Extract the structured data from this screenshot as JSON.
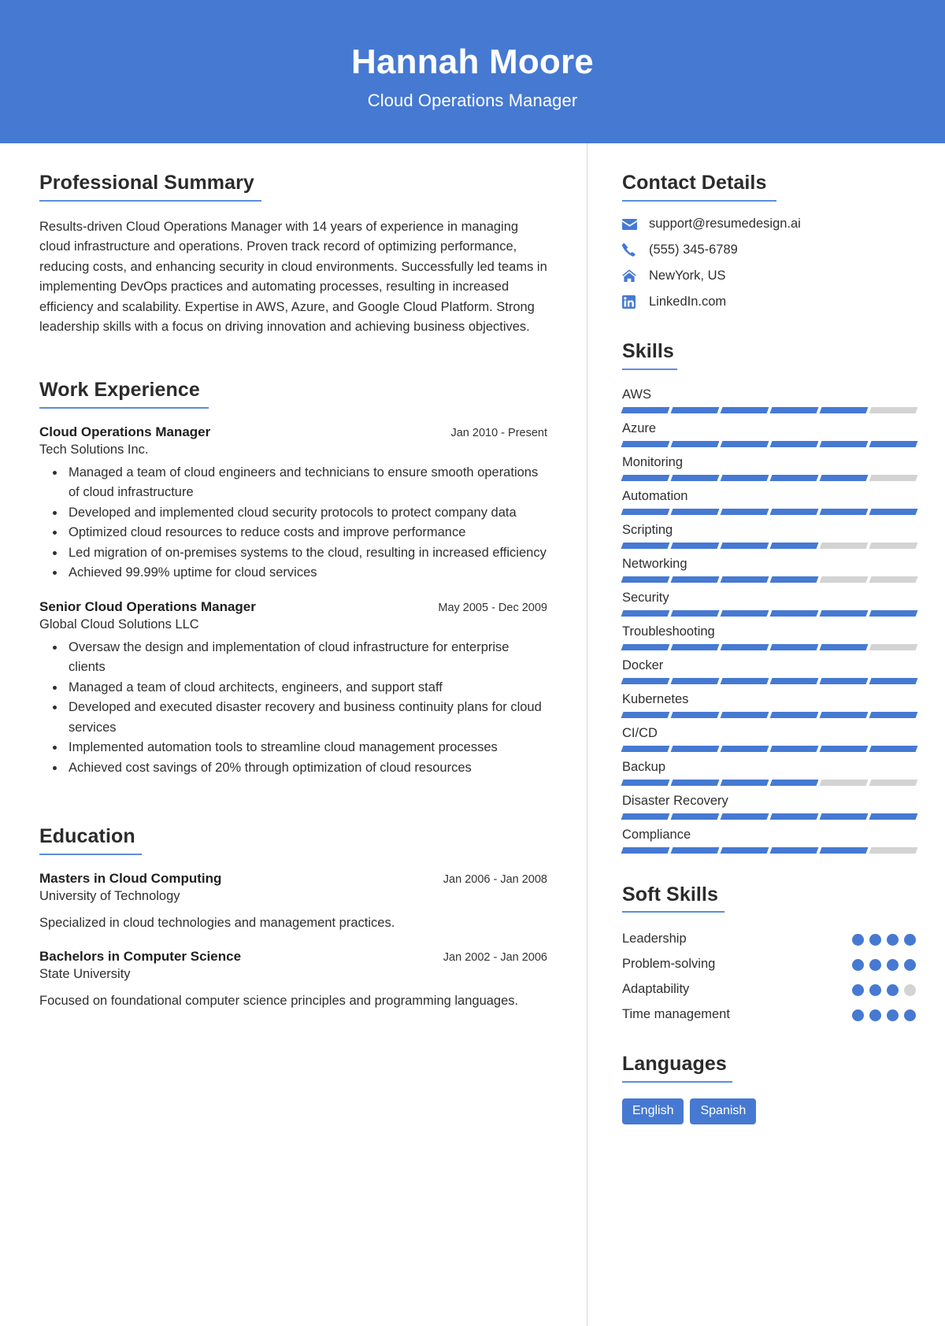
{
  "header": {
    "name": "Hannah Moore",
    "job_title": "Cloud Operations Manager",
    "background_color": "#4679d2"
  },
  "theme": {
    "accent": "#4679d2",
    "muted": "#d3d3d3",
    "text": "#2f2f2f"
  },
  "summary": {
    "heading": "Professional Summary",
    "text": "Results-driven Cloud Operations Manager with 14 years of experience in managing cloud infrastructure and operations. Proven track record of optimizing performance, reducing costs, and enhancing security in cloud environments. Successfully led teams in implementing DevOps practices and automating processes, resulting in increased efficiency and scalability. Expertise in AWS, Azure, and Google Cloud Platform. Strong leadership skills with a focus on driving innovation and achieving business objectives."
  },
  "work_experience": {
    "heading": "Work Experience",
    "entries": [
      {
        "title": "Cloud Operations Manager",
        "date": "Jan 2010 - Present",
        "company": "Tech Solutions Inc.",
        "bullets": [
          "Managed a team of cloud engineers and technicians to ensure smooth operations of cloud infrastructure",
          "Developed and implemented cloud security protocols to protect company data",
          "Optimized cloud resources to reduce costs and improve performance",
          "Led migration of on-premises systems to the cloud, resulting in increased efficiency",
          "Achieved 99.99% uptime for cloud services"
        ]
      },
      {
        "title": "Senior Cloud Operations Manager",
        "date": "May 2005 - Dec 2009",
        "company": "Global Cloud Solutions LLC",
        "bullets": [
          "Oversaw the design and implementation of cloud infrastructure for enterprise clients",
          "Managed a team of cloud architects, engineers, and support staff",
          "Developed and executed disaster recovery and business continuity plans for cloud services",
          "Implemented automation tools to streamline cloud management processes",
          "Achieved cost savings of 20% through optimization of cloud resources"
        ]
      }
    ]
  },
  "education": {
    "heading": "Education",
    "entries": [
      {
        "degree": "Masters in Cloud Computing",
        "date": "Jan 2006 - Jan 2008",
        "school": "University of Technology",
        "description": "Specialized in cloud technologies and management practices."
      },
      {
        "degree": "Bachelors in Computer Science",
        "date": "Jan 2002 - Jan 2006",
        "school": "State University",
        "description": "Focused on foundational computer science principles and programming languages."
      }
    ]
  },
  "contact": {
    "heading": "Contact Details",
    "items": [
      {
        "icon": "envelope-icon",
        "value": "support@resumedesign.ai"
      },
      {
        "icon": "phone-icon",
        "value": "(555) 345-6789"
      },
      {
        "icon": "home-icon",
        "value": "NewYork, US"
      },
      {
        "icon": "linkedin-icon",
        "value": "LinkedIn.com"
      }
    ]
  },
  "skills": {
    "heading": "Skills",
    "segments_total": 6,
    "items": [
      {
        "name": "AWS",
        "filled": 5
      },
      {
        "name": "Azure",
        "filled": 6
      },
      {
        "name": "Monitoring",
        "filled": 5
      },
      {
        "name": "Automation",
        "filled": 6
      },
      {
        "name": "Scripting",
        "filled": 4
      },
      {
        "name": "Networking",
        "filled": 4
      },
      {
        "name": "Security",
        "filled": 6
      },
      {
        "name": "Troubleshooting",
        "filled": 5
      },
      {
        "name": "Docker",
        "filled": 6
      },
      {
        "name": "Kubernetes",
        "filled": 6
      },
      {
        "name": "CI/CD",
        "filled": 6
      },
      {
        "name": "Backup",
        "filled": 4
      },
      {
        "name": "Disaster Recovery",
        "filled": 6
      },
      {
        "name": "Compliance",
        "filled": 5
      }
    ]
  },
  "soft_skills": {
    "heading": "Soft Skills",
    "dots_total": 4,
    "items": [
      {
        "name": "Leadership",
        "filled": 4
      },
      {
        "name": "Problem-solving",
        "filled": 4
      },
      {
        "name": "Adaptability",
        "filled": 3
      },
      {
        "name": "Time management",
        "filled": 4
      }
    ]
  },
  "languages": {
    "heading": "Languages",
    "items": [
      "English",
      "Spanish"
    ]
  }
}
